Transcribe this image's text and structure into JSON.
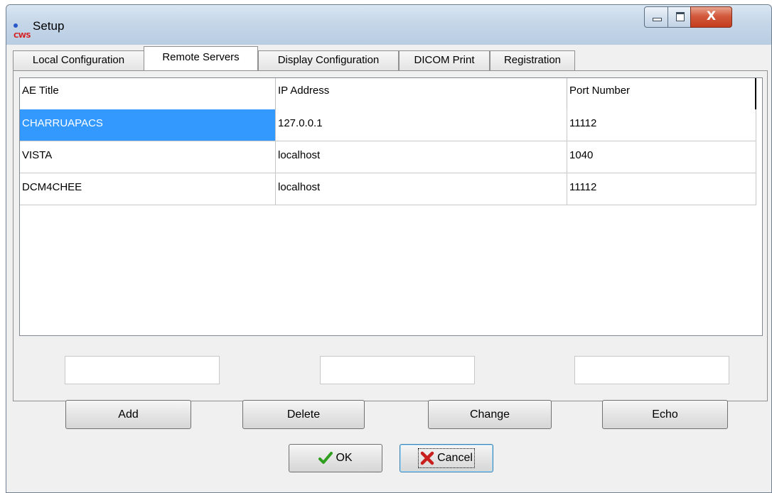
{
  "window": {
    "title": "Setup",
    "icon": "cws-app-icon",
    "icon_text": "CWS"
  },
  "window_controls": {
    "minimize": "minimize-icon",
    "maximize": "maximize-icon",
    "close": "close-icon",
    "close_glyph": "X"
  },
  "tabs": [
    {
      "label": "Local Configuration",
      "active": false
    },
    {
      "label": "Remote Servers",
      "active": true
    },
    {
      "label": "Display Configuration",
      "active": false
    },
    {
      "label": "DICOM Print",
      "active": false
    },
    {
      "label": "Registration",
      "active": false
    }
  ],
  "servers_table": {
    "columns": [
      "AE Title",
      "IP Address",
      "Port Number"
    ],
    "rows": [
      {
        "ae_title": "CHARRUAPACS",
        "ip_address": "127.0.0.1",
        "port": "11112",
        "selected": true
      },
      {
        "ae_title": "VISTA",
        "ip_address": "localhost",
        "port": "1040",
        "selected": false
      },
      {
        "ae_title": "DCM4CHEE",
        "ip_address": "localhost",
        "port": "11112",
        "selected": false
      }
    ]
  },
  "inputs": {
    "ae_title_value": "",
    "ip_address_value": "",
    "port_value": ""
  },
  "actions": {
    "add": "Add",
    "delete": "Delete",
    "change": "Change",
    "echo": "Echo"
  },
  "dialog_buttons": {
    "ok": "OK",
    "cancel": "Cancel"
  },
  "colors": {
    "selection": "#3399ff",
    "close_button": "#c43d1e",
    "ok_check": "#2e9e1e",
    "cancel_x": "#c81e1e"
  }
}
